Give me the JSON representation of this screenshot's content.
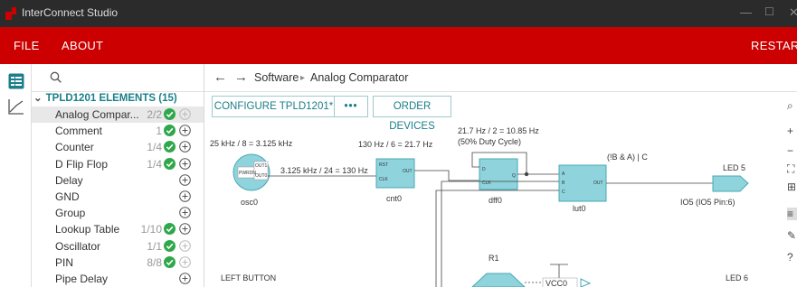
{
  "app": {
    "title": "InterConnect Studio",
    "accent": "#cc0000"
  },
  "menu": {
    "file": "FILE",
    "about": "ABOUT",
    "restart": "RESTART"
  },
  "sidebar": {
    "section_title": "TPLD1201 ELEMENTS (15)",
    "items": [
      {
        "label": "Analog Compar...",
        "count": "2/2",
        "checked": true
      },
      {
        "label": "Comment",
        "count": "1",
        "checked": true
      },
      {
        "label": "Counter",
        "count": "1/4",
        "checked": true
      },
      {
        "label": "D Flip Flop",
        "count": "1/4",
        "checked": true
      },
      {
        "label": "Delay",
        "count": "",
        "checked": false
      },
      {
        "label": "GND",
        "count": "",
        "checked": false
      },
      {
        "label": "Group",
        "count": "",
        "checked": false
      },
      {
        "label": "Lookup Table",
        "count": "1/10",
        "checked": true
      },
      {
        "label": "Oscillator",
        "count": "1/1",
        "checked": true
      },
      {
        "label": "PIN",
        "count": "8/8",
        "checked": true
      },
      {
        "label": "Pipe Delay",
        "count": "",
        "checked": false
      }
    ]
  },
  "breadcrumb": {
    "root": "Software",
    "current": "Analog Comparator"
  },
  "toolbar": {
    "configure": "CONFIGURE TPLD1201*",
    "more": "•••",
    "order": "ORDER DEVICES"
  },
  "schematic": {
    "osc_label": "25 kHz / 8 = 3.125 kHz",
    "osc_name": "osc0",
    "osc_pins": {
      "pwrdn": "PWRDN",
      "out1": "OUT1",
      "out0": "OUT0"
    },
    "wire_label": "3.125 kHz / 24 = 130 Hz",
    "cnt_label": "130 Hz / 6 = 21.7 Hz",
    "cnt_name": "cnt0",
    "cnt_pins": {
      "rst": "RST",
      "clk": "CLK",
      "out": "OUT"
    },
    "dff_label1": "21.7 Hz / 2 = 10.85 Hz",
    "dff_label2": "(50% Duty Cycle)",
    "dff_name": "dff0",
    "dff_pins": {
      "d": "D",
      "clk": "CLK",
      "q": "Q"
    },
    "lut_label": "(!B & A) | C",
    "lut_name": "lut0",
    "lut_pins": {
      "a": "A",
      "b": "B",
      "c": "C",
      "out": "OUT"
    },
    "led5_label": "LED 5",
    "io5_name": "IO5 (IO5 Pin:6)",
    "left_button": "LEFT BUTTON",
    "r1": "R1",
    "vcc": "VCC0",
    "led6_label": "LED 6"
  }
}
